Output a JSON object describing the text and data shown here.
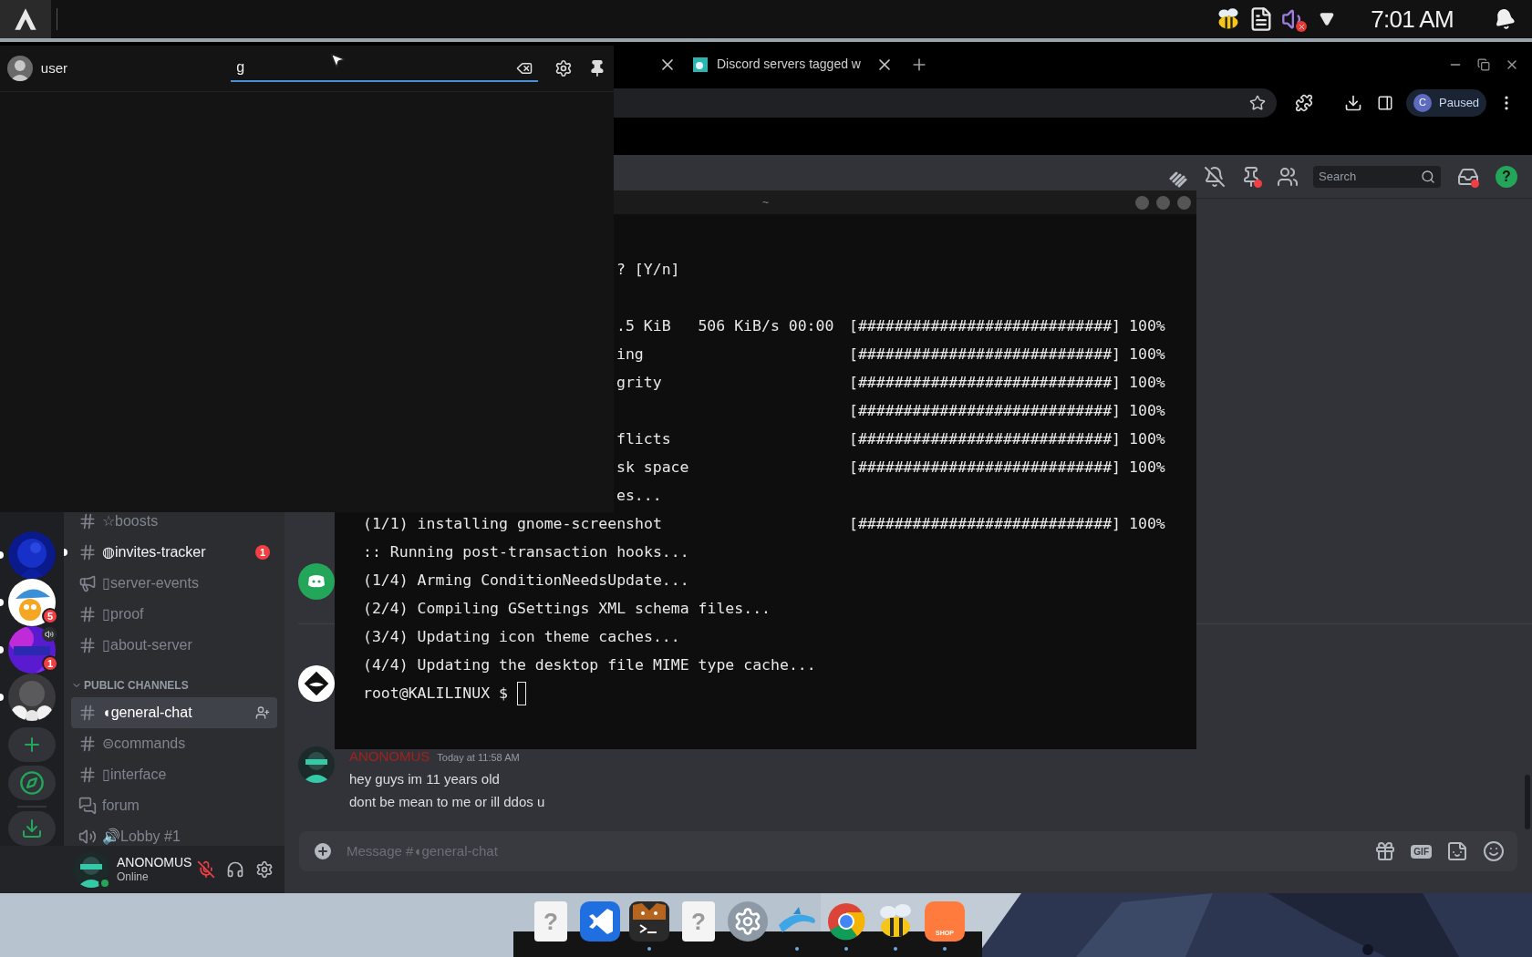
{
  "top_panel": {
    "clock": "7:01 AM"
  },
  "launcher": {
    "user": "user",
    "search": {
      "value": "g"
    }
  },
  "browser": {
    "tab": {
      "title": "Discord servers tagged w"
    },
    "profile": {
      "initial": "C",
      "status": "Paused"
    }
  },
  "discord": {
    "servers": [
      {
        "kind": "blue",
        "unread": true,
        "voice": false
      },
      {
        "kind": "umbrella",
        "unread": true,
        "badge": "5",
        "voice": false
      },
      {
        "kind": "purple",
        "unread": true,
        "badge": "1",
        "voice": true
      },
      {
        "kind": "cat",
        "unread": true,
        "voice": false
      },
      {
        "kind": "add"
      },
      {
        "kind": "explore"
      },
      {
        "kind": "download"
      }
    ],
    "channels": [
      {
        "kind": "text",
        "name": "☆boosts",
        "selected": false,
        "unread": false
      },
      {
        "kind": "text",
        "name": "◍invites-tracker",
        "selected": false,
        "unread": true,
        "badge": "1"
      },
      {
        "kind": "announcement",
        "name": "▯server-events",
        "selected": false,
        "unread": false
      },
      {
        "kind": "text",
        "name": "▯proof",
        "selected": false,
        "unread": false
      },
      {
        "kind": "text",
        "name": "▯about-server",
        "selected": false,
        "unread": false
      },
      {
        "kind": "category",
        "name": "PUBLIC CHANNELS",
        "expanded": true
      },
      {
        "kind": "text",
        "name": "◖general-chat",
        "selected": true,
        "unread": false
      },
      {
        "kind": "text",
        "name": "⊜commands",
        "selected": false,
        "unread": false
      },
      {
        "kind": "text",
        "name": "▯interface",
        "selected": false,
        "unread": false
      },
      {
        "kind": "forum",
        "name": "forum",
        "selected": false,
        "unread": false
      },
      {
        "kind": "voice",
        "name": "🔊Lobby #1",
        "selected": false,
        "unread": false
      }
    ],
    "user": {
      "name": "ANONOMUS",
      "status": "Online",
      "muted": true
    },
    "header": {
      "search_placeholder": "Search",
      "help": "?"
    },
    "messages": [
      {
        "kind": "bot"
      },
      {
        "kind": "mask"
      },
      {
        "kind": "person",
        "author": "ANONOMUS",
        "time": "Today at 11:58 AM",
        "lines": [
          "hey guys im 11 years old",
          "dont be mean to me or ill ddos u"
        ]
      }
    ],
    "composer": {
      "placeholder": "Message #◖general-chat",
      "gif": "GIF"
    }
  },
  "terminal": {
    "title": "~",
    "prompt": "root@KALILINUX $",
    "lines": [
      {
        "kind": "clipped",
        "text": "? [Y/n]"
      },
      {
        "kind": "blank"
      },
      {
        "kind": "clipped",
        "text": ".5 KiB   506 KiB/s 00:00",
        "bar": "[############################]",
        "percent": "100%"
      },
      {
        "kind": "clipped",
        "text": "ing",
        "bar": "[############################]",
        "percent": "100%"
      },
      {
        "kind": "clipped",
        "text": "grity",
        "bar": "[############################]",
        "percent": "100%"
      },
      {
        "kind": "clipped",
        "bar": "[############################]",
        "percent": "100%"
      },
      {
        "kind": "clipped",
        "text": "flicts",
        "bar": "[############################]",
        "percent": "100%"
      },
      {
        "kind": "clipped",
        "text": "sk space",
        "bar": "[############################]",
        "percent": "100%"
      },
      {
        "kind": "clipped",
        "text": "es..."
      },
      {
        "kind": "full",
        "text": "(1/1) installing gnome-screenshot",
        "bar": "[############################]",
        "percent": "100%"
      },
      {
        "kind": "full",
        "text": ":: Running post-transaction hooks..."
      },
      {
        "kind": "full",
        "text": "(1/4) Arming ConditionNeedsUpdate..."
      },
      {
        "kind": "full",
        "text": "(2/4) Compiling GSettings XML schema files..."
      },
      {
        "kind": "full",
        "text": "(3/4) Updating icon theme caches..."
      },
      {
        "kind": "full",
        "text": "(4/4) Updating the desktop file MIME type cache..."
      }
    ]
  },
  "dock": [
    {
      "kind": "unknown",
      "glyph": "?",
      "running": false
    },
    {
      "kind": "vscode",
      "running": false
    },
    {
      "kind": "terminal",
      "running": true
    },
    {
      "kind": "unknown",
      "glyph": "?",
      "running": false
    },
    {
      "kind": "settings",
      "running": false
    },
    {
      "kind": "dolphin",
      "running": true
    },
    {
      "kind": "chrome",
      "running": true
    },
    {
      "kind": "bee",
      "running": true
    },
    {
      "kind": "shop",
      "label": "SHOP",
      "running": true
    }
  ]
}
